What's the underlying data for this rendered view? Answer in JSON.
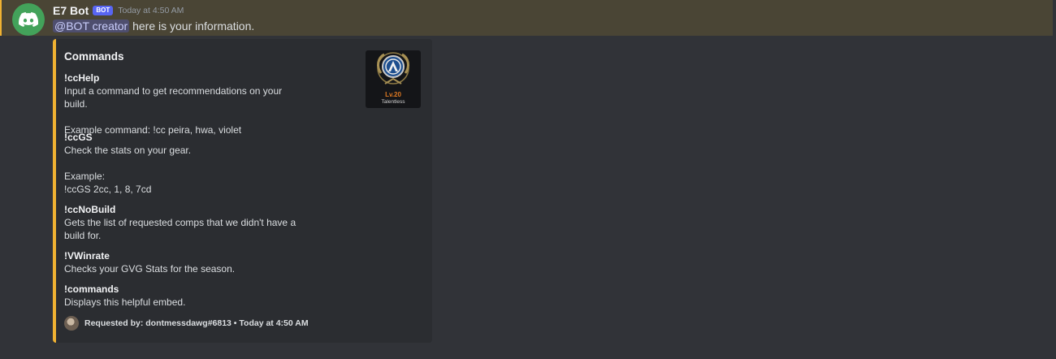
{
  "message": {
    "username": "E7 Bot",
    "bot_tag": "BOT",
    "timestamp": "Today at 4:50 AM",
    "mention": "@BOT creator",
    "text": " here is your information."
  },
  "embed": {
    "accent_color": "#f0b232",
    "title": "Commands",
    "thumbnail": {
      "level": "Lv.20",
      "subtitle": "Talentless"
    },
    "fields": [
      {
        "name": "!ccHelp",
        "value": "Input a command to get recommendations on your build.\n\nExample command: !cc peira, hwa, violet"
      },
      {
        "name": "!ccGS",
        "value": "Check the stats on your gear.\n\nExample:\n!ccGS 2cc, 1, 8, 7cd"
      },
      {
        "name": "!ccNoBuild",
        "value": "Gets the list of requested comps that we didn't have a\nbuild for."
      },
      {
        "name": "!VWinrate",
        "value": "Checks your GVG Stats for the season."
      },
      {
        "name": "!commands",
        "value": "Displays this helpful embed."
      }
    ],
    "footer": "Requested by: dontmessdawg#6813 • Today at 4:50 AM"
  },
  "colors": {
    "background": "#313338",
    "embed_background": "#2b2d31",
    "mention_highlight": "#4a4535",
    "avatar": "#43a25a",
    "bot_tag": "#5865f2"
  },
  "icons": {
    "avatar": "discord-logo-icon",
    "thumbnail": "guild-emblem-icon",
    "footer": "user-avatar-icon"
  }
}
